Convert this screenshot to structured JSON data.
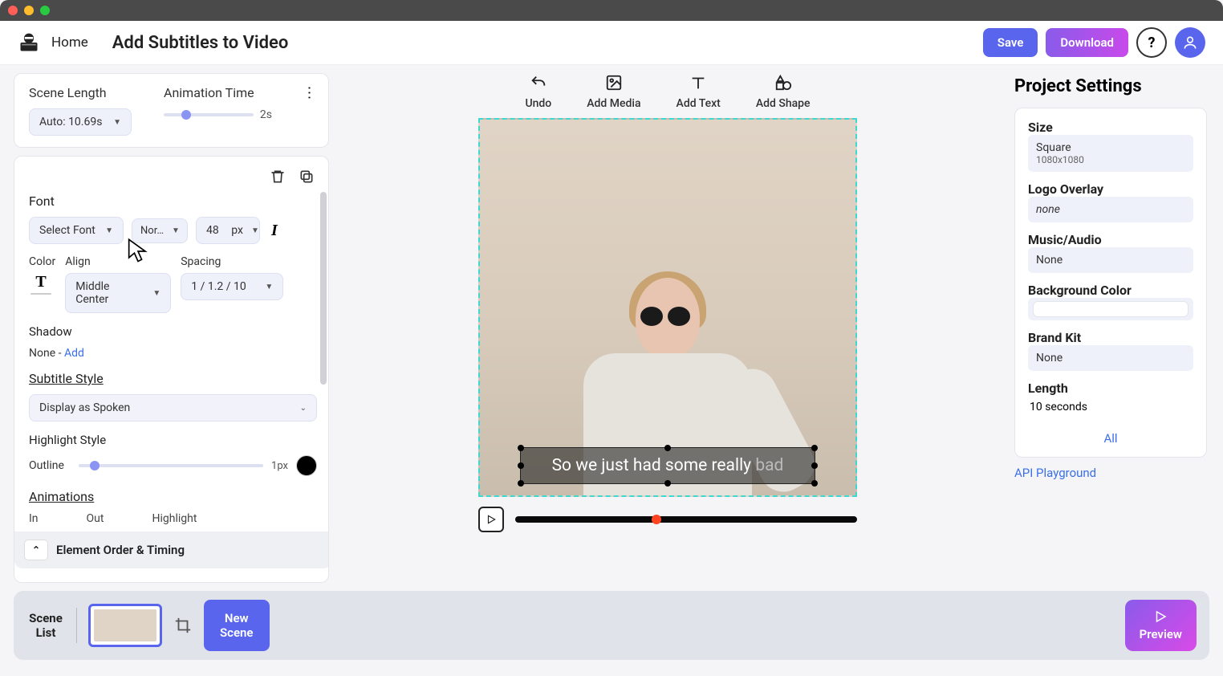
{
  "topbar": {
    "home": "Home",
    "title": "Add Subtitles to Video",
    "save": "Save",
    "download": "Download"
  },
  "sceneCard": {
    "lengthLabel": "Scene Length",
    "lengthValue": "Auto: 10.69s",
    "animLabel": "Animation Time",
    "animValue": "2s"
  },
  "props": {
    "fontLabel": "Font",
    "fontSelect": "Select Font",
    "weight": "Nor…",
    "size": "48",
    "sizeUnit": "px",
    "colorLabel": "Color",
    "alignLabel": "Align",
    "alignValue": "Middle Center",
    "spacingLabel": "Spacing",
    "spacingValue": "1 / 1.2 / 10",
    "shadowLabel": "Shadow",
    "shadowValue": "None -",
    "shadowAdd": "Add",
    "subtitleStyleLabel": "Subtitle Style",
    "subtitleStyleValue": "Display as Spoken",
    "highlightLabel": "Highlight Style",
    "outlineLabel": "Outline",
    "outlineValue": "1px",
    "animationsLabel": "Animations",
    "animIn": "In",
    "animOut": "Out",
    "animHighlight": "Highlight",
    "elementOrder": "Element Order & Timing"
  },
  "toolbar": {
    "undo": "Undo",
    "addMedia": "Add Media",
    "addText": "Add Text",
    "addShape": "Add Shape"
  },
  "subtitle": {
    "text": "So we just had some really",
    "dim": "bad"
  },
  "right": {
    "title": "Project Settings",
    "sizeLabel": "Size",
    "sizeName": "Square",
    "sizeDims": "1080x1080",
    "logoLabel": "Logo Overlay",
    "logoValue": "none",
    "musicLabel": "Music/Audio",
    "musicValue": "None",
    "bgLabel": "Background Color",
    "brandLabel": "Brand Kit",
    "brandValue": "None",
    "lengthLabel": "Length",
    "lengthValue": "10 seconds",
    "all": "All",
    "api": "API Playground"
  },
  "bottom": {
    "sceneList": "Scene List",
    "newScene": "New Scene",
    "preview": "Preview"
  }
}
